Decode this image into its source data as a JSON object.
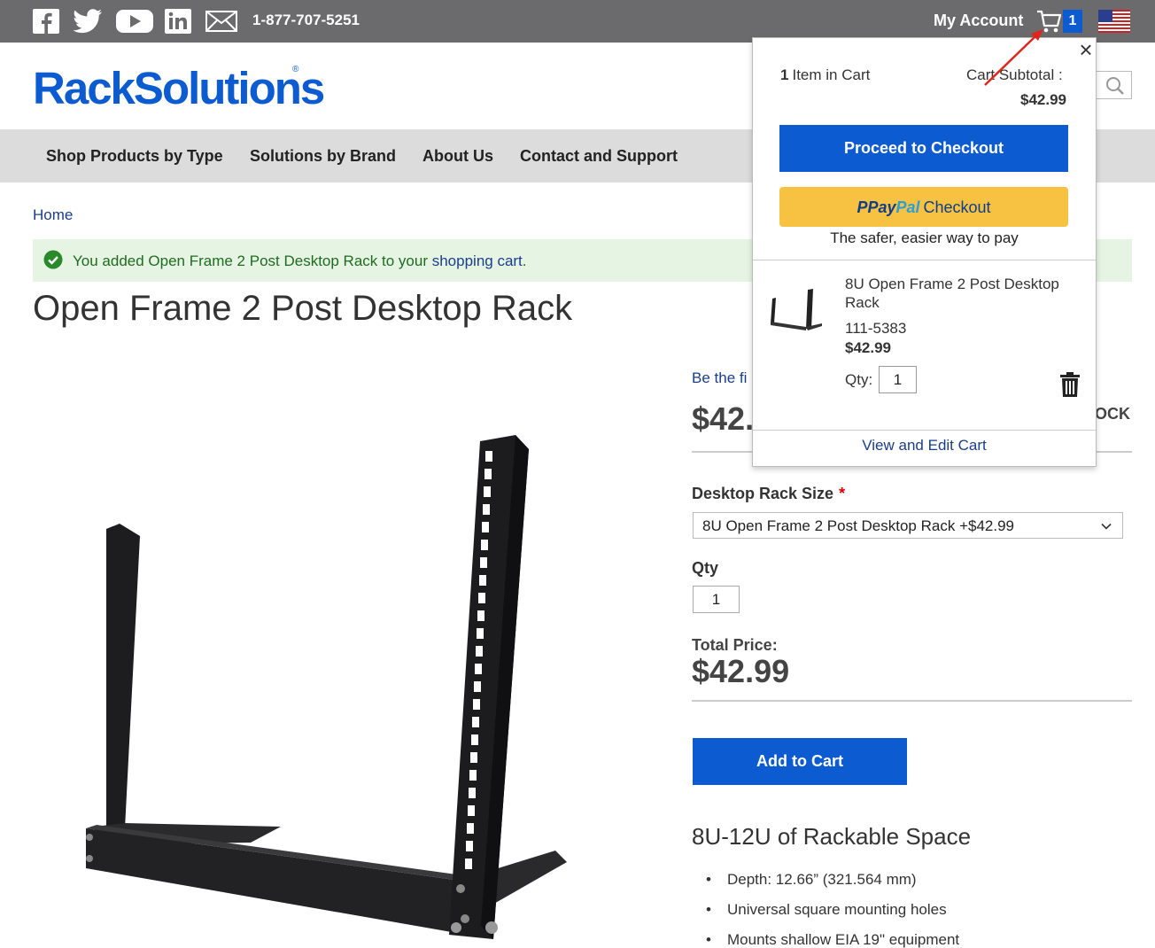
{
  "topbar": {
    "social": [
      "facebook-icon",
      "twitter-icon",
      "youtube-icon",
      "linkedin-icon",
      "email-icon"
    ],
    "phone": "1-877-707-5251",
    "my_account": "My Account",
    "cart_count": "1"
  },
  "header": {
    "logo": "RackSolutions",
    "logo_reg": "®"
  },
  "nav": {
    "items": [
      {
        "label": "Shop Products by Type"
      },
      {
        "label": "Solutions by Brand"
      },
      {
        "label": "About Us"
      },
      {
        "label": "Contact and Support"
      }
    ]
  },
  "breadcrumb": {
    "home": "Home"
  },
  "message": {
    "prefix": "You added Open Frame 2 Post Desktop Rack to your ",
    "link": "shopping cart",
    "suffix": "."
  },
  "product": {
    "title": "Open Frame 2 Post Desktop Rack",
    "review_partial": "Be the fi",
    "price_partial": "$42.",
    "stock_partial": "OCK",
    "option_label": "Desktop Rack Size",
    "option_required": "*",
    "option_value": "8U Open Frame 2 Post Desktop Rack +$42.99",
    "qty_label": "Qty",
    "qty_value": "1",
    "total_label": "Total Price:",
    "total_value": "$42.99",
    "add_to_cart": "Add to Cart",
    "features_title": "8U-12U of Rackable Space",
    "features": [
      "Depth: 12.66” (321.564 mm)",
      "Universal square mounting holes",
      "Mounts shallow EIA 19\" equipment"
    ]
  },
  "minicart": {
    "close": "×",
    "count_num": "1",
    "count_text": "Item in Cart",
    "subtotal_label": "Cart Subtotal :",
    "subtotal_value": "$42.99",
    "checkout_button": "Proceed to Checkout",
    "paypal_p": "P",
    "paypal_pay": "Pay",
    "paypal_pal": "Pal",
    "paypal_checkout": "Checkout",
    "paypal_tagline": "The safer, easier way to pay",
    "item": {
      "name": "8U Open Frame 2 Post Desktop Rack",
      "sku": "111-5383",
      "price": "$42.99",
      "qty_label": "Qty:",
      "qty_value": "1"
    },
    "view_edit": "View and Edit Cart"
  },
  "colors": {
    "brand_blue": "#0d5bd1",
    "topbar_gray": "#6b6b6d",
    "paypal_yellow": "#f7c141",
    "annotation_red": "#e0261b"
  }
}
